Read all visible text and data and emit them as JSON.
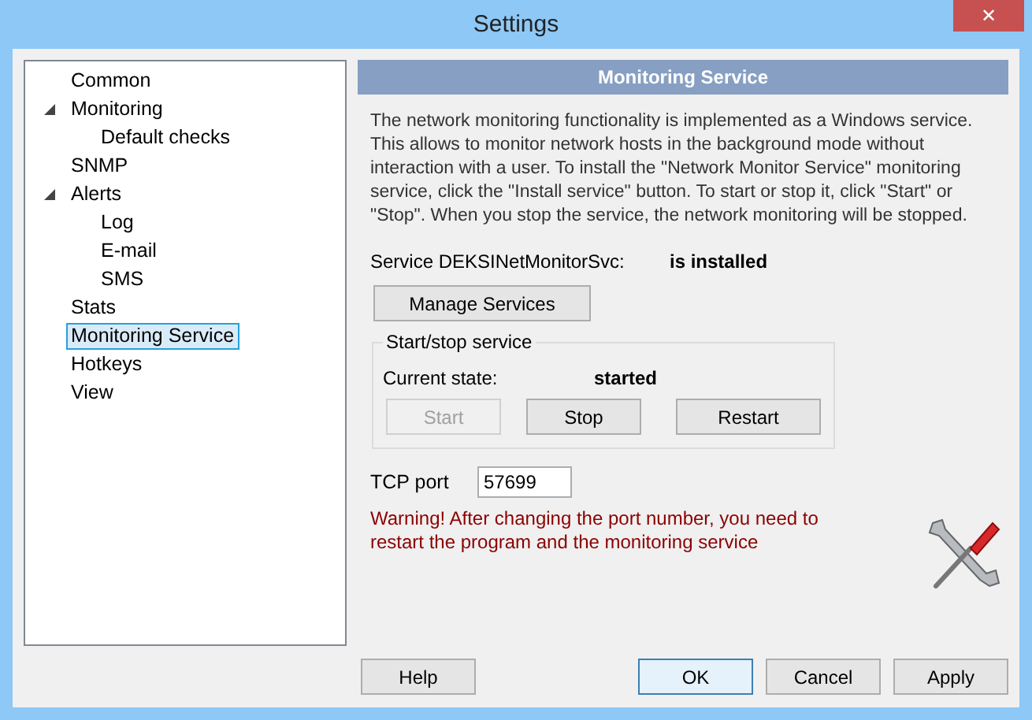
{
  "window": {
    "title": "Settings",
    "close": "✕"
  },
  "tree": [
    {
      "label": "Common",
      "selected": false
    },
    {
      "label": "Monitoring",
      "selected": false,
      "expanded": true,
      "children": [
        {
          "label": "Default checks",
          "selected": false
        }
      ]
    },
    {
      "label": "SNMP",
      "selected": false
    },
    {
      "label": "Alerts",
      "selected": false,
      "expanded": true,
      "children": [
        {
          "label": "Log",
          "selected": false
        },
        {
          "label": "E-mail",
          "selected": false
        },
        {
          "label": "SMS",
          "selected": false
        }
      ]
    },
    {
      "label": "Stats",
      "selected": false
    },
    {
      "label": "Monitoring Service",
      "selected": true
    },
    {
      "label": "Hotkeys",
      "selected": false
    },
    {
      "label": "View",
      "selected": false
    }
  ],
  "panel": {
    "header": "Monitoring Service",
    "description": "The network monitoring functionality is implemented as a Windows service. This allows to monitor network hosts in the background mode without interaction with a user. To install the \"Network Monitor Service\" monitoring service, click the \"Install service\" button. To start or stop it, click \"Start\" or \"Stop\". When you stop the service, the network monitoring will be stopped.",
    "service_label": "Service DEKSINetMonitorSvc:",
    "service_status": "is installed",
    "manage_button": "Manage Services",
    "group": {
      "title": "Start/stop service",
      "state_label": "Current state:",
      "state_value": "started",
      "buttons": [
        {
          "label": "Start",
          "disabled": true
        },
        {
          "label": "Stop",
          "disabled": false
        },
        {
          "label": "Restart",
          "disabled": false
        }
      ]
    },
    "tcp_port": {
      "label": "TCP port",
      "value": "57699"
    },
    "warning": "Warning! After changing the port number, you need to restart the program and the monitoring service"
  },
  "footer": {
    "help": "Help",
    "buttons": [
      {
        "label": "OK",
        "default": true
      },
      {
        "label": "Cancel",
        "default": false
      },
      {
        "label": "Apply",
        "default": false
      }
    ]
  }
}
